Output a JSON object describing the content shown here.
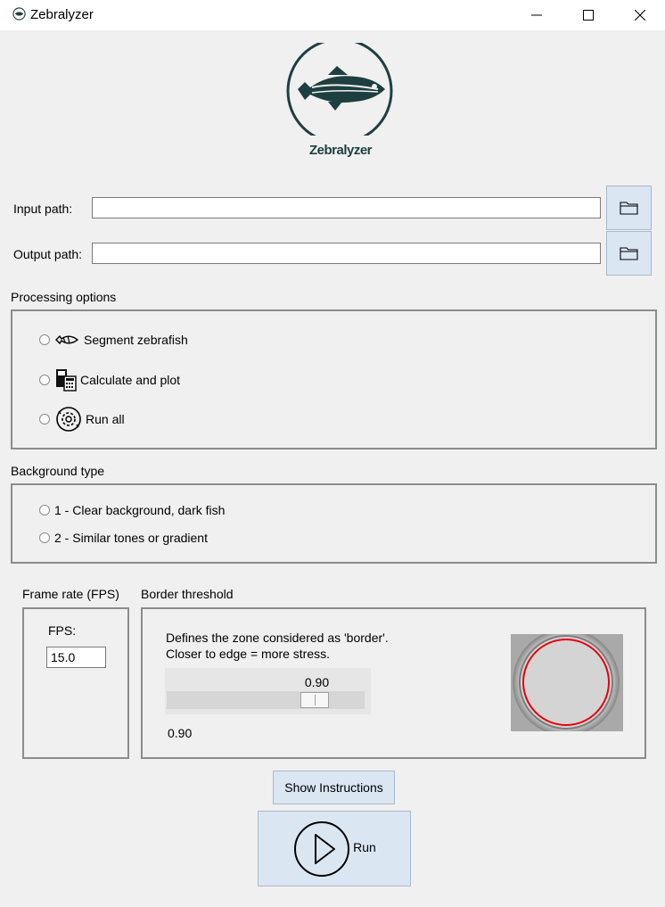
{
  "window": {
    "title": "Zebralyzer",
    "minimize_icon": "minimize-icon",
    "maximize_icon": "maximize-icon",
    "close_icon": "close-icon"
  },
  "logo": {
    "text": "Zebralyzer",
    "icon": "zebrafish-logo"
  },
  "paths": {
    "input_label": "Input path:",
    "input_value": "",
    "output_label": "Output path:",
    "output_value": "",
    "browse_icon": "folder-icon"
  },
  "processing": {
    "title": "Processing options",
    "options": [
      {
        "label": "Segment zebrafish",
        "icon": "fish-segment-icon",
        "selected": false
      },
      {
        "label": "Calculate and plot",
        "icon": "calculator-icon",
        "selected": false
      },
      {
        "label": "Run all",
        "icon": "gear-cycle-icon",
        "selected": false
      }
    ]
  },
  "background": {
    "title": "Background type",
    "options": [
      {
        "label": "1 - Clear background, dark fish",
        "selected": false
      },
      {
        "label": "2 - Similar tones or gradient",
        "selected": false
      }
    ]
  },
  "framerate": {
    "title": "Frame rate (FPS)",
    "label": "FPS:",
    "value": "15.0"
  },
  "border": {
    "title": "Border threshold",
    "desc1": "Defines the zone considered as 'border'.",
    "desc2": "Closer to edge = more stress.",
    "slider_value": 0.9,
    "slider_min": 0.0,
    "slider_max": 1.0,
    "slider_label": "0.90",
    "value_text": "0.90",
    "preview_icon": "well-preview-image",
    "ring_color": "#e8000b"
  },
  "buttons": {
    "instructions": "Show Instructions",
    "run": "Run",
    "run_icon": "play-icon"
  },
  "colors": {
    "button_bg": "#dbe6f3",
    "window_bg": "#f0f0f0",
    "logo": "#1e3f40"
  }
}
